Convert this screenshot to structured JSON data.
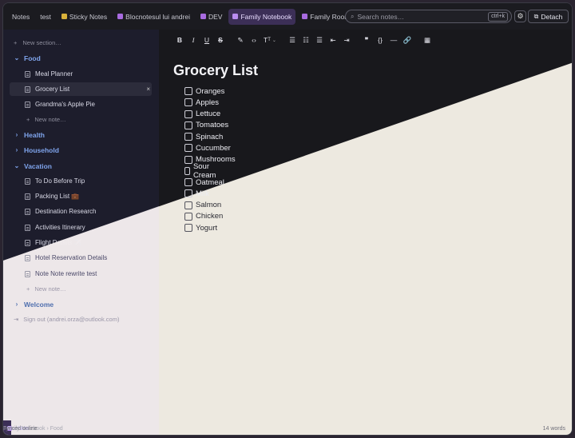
{
  "tabs": [
    {
      "label": "Notes",
      "color": ""
    },
    {
      "label": "test",
      "color": ""
    },
    {
      "label": "Sticky Notes",
      "color": "#d8b13a"
    },
    {
      "label": "Blocnotesul lui andrei",
      "color": "#a86be0"
    },
    {
      "label": "DEV",
      "color": "#a86be0"
    },
    {
      "label": "Family Notebook",
      "color": "#a86be0"
    },
    {
      "label": "Family Room",
      "color": "#a86be0"
    }
  ],
  "search": {
    "placeholder": "Search notes…",
    "shortcut": "ctrl+k"
  },
  "detach_label": "Detach",
  "sidebar": {
    "new_section": "New section…",
    "food": "Food",
    "meal_planner": "Meal Planner",
    "grocery_list": "Grocery List",
    "apple_pie": "Grandma's Apple Pie",
    "new_note_1": "New note…",
    "health": "Health",
    "household": "Household",
    "vacation": "Vacation",
    "todo_trip": "To Do Before Trip",
    "packing": "Packing List 💼",
    "destination": "Destination Research",
    "activities": "Activities Itinerary",
    "flight": "Flight Details ✈️",
    "hotel": "Hotel Reservation Details",
    "rewrite": "Note Note rewrite test",
    "new_note_2": "New note…",
    "welcome": "Welcome",
    "signout": "Sign out (andrei.orza@outlook.com)"
  },
  "note": {
    "title": "Grocery List",
    "items": [
      "Oranges",
      "Apples",
      "Lettuce",
      "Tomatoes",
      "Spinach",
      "Cucumber",
      "Mushrooms",
      "Sour Cream",
      "Oatmeal",
      "Milk",
      "Salmon",
      "Chicken",
      "Yogurt"
    ]
  },
  "status": {
    "app": "OneNote",
    "breadcrumb": "Family Notebook › Food",
    "sync": "synced online",
    "words": "14 words"
  },
  "colors": {
    "accent": "#3c2f57",
    "section": "#7fa4ec",
    "light_overlay": "#f6f1e8"
  }
}
